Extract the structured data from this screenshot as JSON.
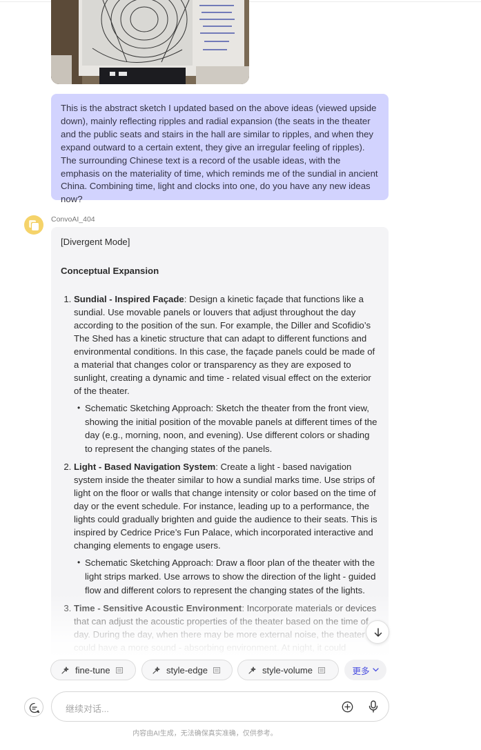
{
  "user_message": {
    "text": "This is the abstract sketch I updated based on the above ideas (viewed upside down), mainly reflecting ripples and radial expansion (the seats in the theater and the public seats and stairs in the hall are similar to ripples, and when they expand outward to a certain extent, they give an irregular feeling of ripples). The surrounding Chinese text is a record of the usable ideas, with the emphasis on the materiality of time, which reminds me of the sundial in ancient China. Combining time, light and clocks into one, do you have any new ideas now?"
  },
  "bot": {
    "name": "ConvoAI_404",
    "mode": "[Divergent Mode]",
    "heading": "Conceptual Expansion",
    "items": [
      {
        "title": "Sundial - Inspired Façade",
        "body": ": Design a kinetic façade that functions like a sundial. Use movable panels or louvers that adjust throughout the day according to the position of the sun. For example, the Diller and Scofidio’s The Shed has a kinetic structure that can adapt to different functions and environmental conditions. In this case, the façade panels could be made of a material that changes color or transparency as they are exposed to sunlight, creating a dynamic and time - related visual effect on the exterior of the theater.",
        "sub": "Schematic Sketching Approach: Sketch the theater from the front view, showing the initial position of the movable panels at different times of the day (e.g., morning, noon, and evening). Use different colors or shading to represent the changing states of the panels."
      },
      {
        "title": "Light - Based Navigation System",
        "body": ": Create a light - based navigation system inside the theater similar to how a sundial marks time. Use strips of light on the floor or walls that change intensity or color based on the time of day or the event schedule. For instance, leading up to a performance, the lights could gradually brighten and guide the audience to their seats. This is inspired by Cedrice Price’s Fun Palace, which incorporated interactive and changing elements to engage users.",
        "sub": "Schematic Sketching Approach: Draw a floor plan of the theater with the light strips marked. Use arrows to show the direction of the light - guided flow and different colors to represent the changing states of the lights."
      },
      {
        "title": "Time - Sensitive Acoustic Environment",
        "body": ": Incorporate materials or devices that can adjust the acoustic properties of the theater based on the time of day. During the day, when there may be more external noise, the theater could have a more sound - absorbing environment. At night, it could",
        "sub": ""
      }
    ]
  },
  "chips": [
    {
      "label": "fine-tune"
    },
    {
      "label": "style-edge"
    },
    {
      "label": "style-volume"
    }
  ],
  "more_label": "更多",
  "input": {
    "placeholder": "继续对话..."
  },
  "disclaimer": "内容由AI生成，无法确保真实准确，仅供参考。",
  "colors": {
    "user_bubble": "#d2d3fe",
    "bot_bubble": "#f4f4f6",
    "accent": "#4a4fe0"
  }
}
